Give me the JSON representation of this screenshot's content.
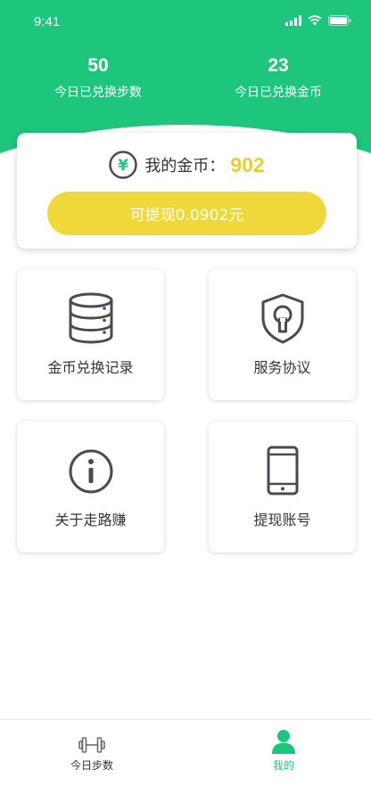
{
  "status_bar": {
    "time": "9:41"
  },
  "stats": [
    {
      "value": "50",
      "label": "今日已兑换步数"
    },
    {
      "value": "23",
      "label": "今日已兑换金币"
    }
  ],
  "coin_card": {
    "label": "我的金币：",
    "value": "902",
    "withdraw_label": "可提现0.0902元",
    "coin_symbol": "¥"
  },
  "tiles": [
    {
      "label": "金币兑换记录",
      "icon": "database-icon"
    },
    {
      "label": "服务协议",
      "icon": "shield-lock-icon"
    },
    {
      "label": "关于走路赚",
      "icon": "info-icon"
    },
    {
      "label": "提现账号",
      "icon": "phone-icon"
    }
  ],
  "tabbar": [
    {
      "label": "今日步数",
      "icon": "dumbbell-icon",
      "active": false
    },
    {
      "label": "我的",
      "icon": "person-icon",
      "active": true
    }
  ],
  "colors": {
    "brand_green": "#1ec57c",
    "coin_yellow": "#eace31",
    "button_yellow": "#eed83a",
    "icon_gray": "#4a4a52"
  }
}
